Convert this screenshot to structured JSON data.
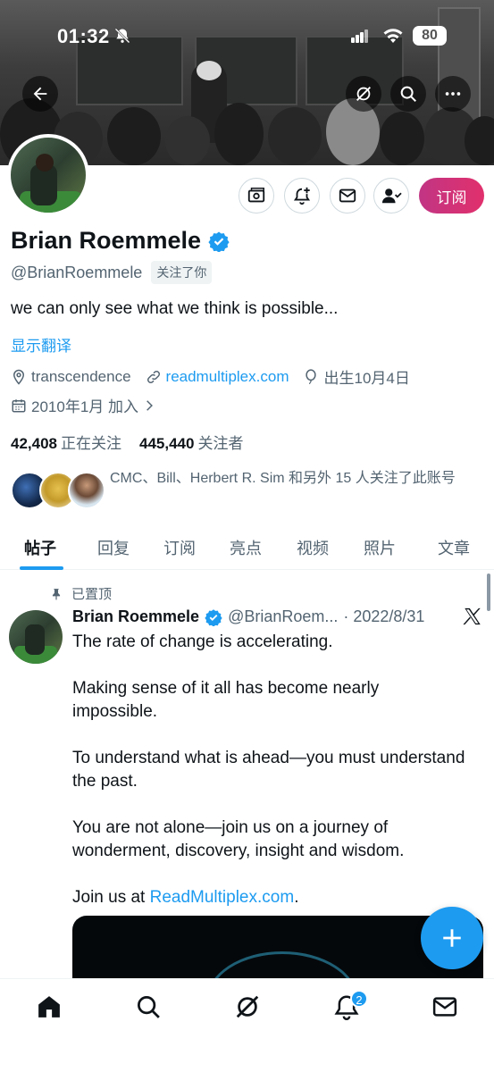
{
  "status_bar": {
    "time": "01:32",
    "battery": "80"
  },
  "profile": {
    "name": "Brian Roemmele",
    "handle": "@BrianRoemmele",
    "follows_you": "关注了你",
    "bio": "we can only see what we think is possible...",
    "translate_label": "显示翻译",
    "location": "transcendence",
    "website": "readmultiplex.com",
    "birthday": "出生10月4日",
    "joined": "2010年1月 加入",
    "following_count": "42,408",
    "following_label": "正在关注",
    "followers_count": "445,440",
    "followers_label": "关注者",
    "known_followers_text": "CMC、Bill、Herbert R. Sim 和另外 15 人关注了此账号",
    "subscribe_label": "订阅"
  },
  "tabs": [
    {
      "label": "帖子"
    },
    {
      "label": "回复"
    },
    {
      "label": "订阅"
    },
    {
      "label": "亮点"
    },
    {
      "label": "视频"
    },
    {
      "label": "照片"
    },
    {
      "label": "文章"
    }
  ],
  "pinned_post": {
    "pinned_label": "已置顶",
    "author_name": "Brian Roemmele",
    "author_handle": "@BrianRoem...",
    "date": "· 2022/8/31",
    "paragraphs": [
      "The rate of change is accelerating.",
      "Making sense of it all has become nearly impossible.",
      "To understand what is ahead—you must understand the past.",
      "You are not alone—join us on a journey of wonderment, discovery, insight and wisdom."
    ],
    "join_prefix": "Join us at ",
    "join_link": "ReadMultiplex.com",
    "join_suffix": "."
  },
  "bottom_nav": {
    "notifications_badge": "2"
  },
  "colors": {
    "accent": "#1d9bf0",
    "subscribe_start": "#c13584",
    "subscribe_end": "#e1306c",
    "secondary_text": "#536471"
  }
}
